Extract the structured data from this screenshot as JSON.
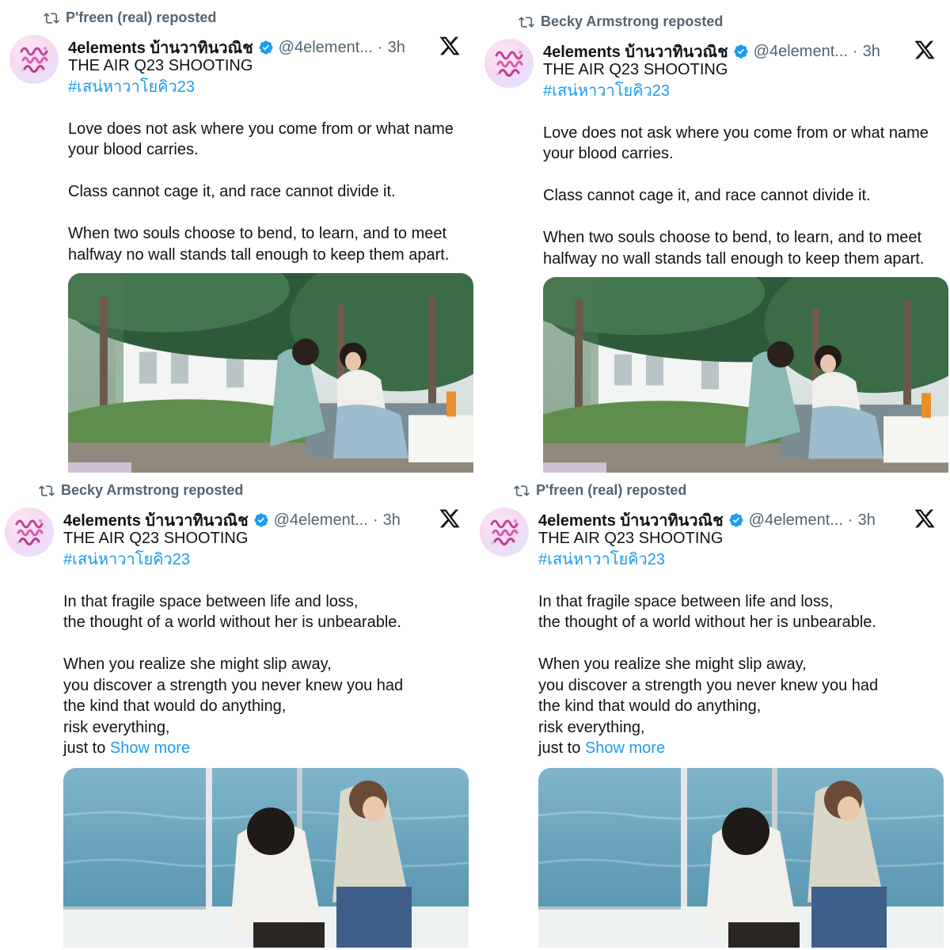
{
  "tweets": [
    {
      "reposted_by": "P'freen (real) reposted",
      "author_name": "4elements บ้านวาทินวณิช",
      "handle": "@4element...",
      "separator": "·",
      "time": "3h",
      "title": "THE AIR Q23 SHOOTING",
      "hashtag": "#เสน่หาวาโยคิว23",
      "paragraphs": [
        [
          "Love does not ask where you come from or what name",
          "your blood carries."
        ],
        [
          "Class cannot cage it, and race cannot divide it."
        ],
        [
          "When two souls choose to bend, to learn, and to meet",
          "halfway no wall stands tall enough to keep them apart."
        ]
      ],
      "media": "garden-scene"
    },
    {
      "reposted_by": "Becky Armstrong reposted",
      "author_name": "4elements บ้านวาทินวณิช",
      "handle": "@4element...",
      "separator": "·",
      "time": "3h",
      "title": "THE AIR Q23 SHOOTING",
      "hashtag": "#เสน่หาวาโยคิว23",
      "paragraphs": [
        [
          "Love does not ask where you come from or what name",
          "your blood carries."
        ],
        [
          "Class cannot cage it, and race cannot divide it."
        ],
        [
          "When two souls choose to bend, to learn, and to meet",
          "halfway no wall stands tall enough to keep them apart."
        ]
      ],
      "media": "garden-scene"
    },
    {
      "reposted_by": "Becky Armstrong reposted",
      "author_name": "4elements บ้านวาทินวณิช",
      "handle": "@4element...",
      "separator": "·",
      "time": "3h",
      "title": "THE AIR Q23 SHOOTING",
      "hashtag": "#เสน่หาวาโยคิว23",
      "paragraphs": [
        [
          "In that fragile space between life and loss,",
          "the thought of a world without her is unbearable."
        ],
        [
          "When you realize she might slip away,",
          "you discover a strength you never knew you had",
          "the kind that would do anything,",
          "risk everything,"
        ]
      ],
      "truncated_line": "just to",
      "show_more": "Show more",
      "media": "boat-scene"
    },
    {
      "reposted_by": "P'freen (real) reposted",
      "author_name": "4elements บ้านวาทินวณิช",
      "handle": "@4element...",
      "separator": "·",
      "time": "3h",
      "title": "THE AIR Q23 SHOOTING",
      "hashtag": "#เสน่หาวาโยคิว23",
      "paragraphs": [
        [
          "In that fragile space between life and loss,",
          "the thought of a world without her is unbearable."
        ],
        [
          "When you realize she might slip away,",
          "you discover a strength you never knew you had",
          "the kind that would do anything,",
          "risk everything,"
        ]
      ],
      "truncated_line": "just to",
      "show_more": "Show more",
      "media": "boat-scene"
    }
  ],
  "icons": {
    "repost": "repost-icon",
    "verified": "verified-badge-icon",
    "platform": "x-logo-icon"
  },
  "colors": {
    "text": "#0f1419",
    "secondary": "#536471",
    "link": "#1d9bf0"
  }
}
